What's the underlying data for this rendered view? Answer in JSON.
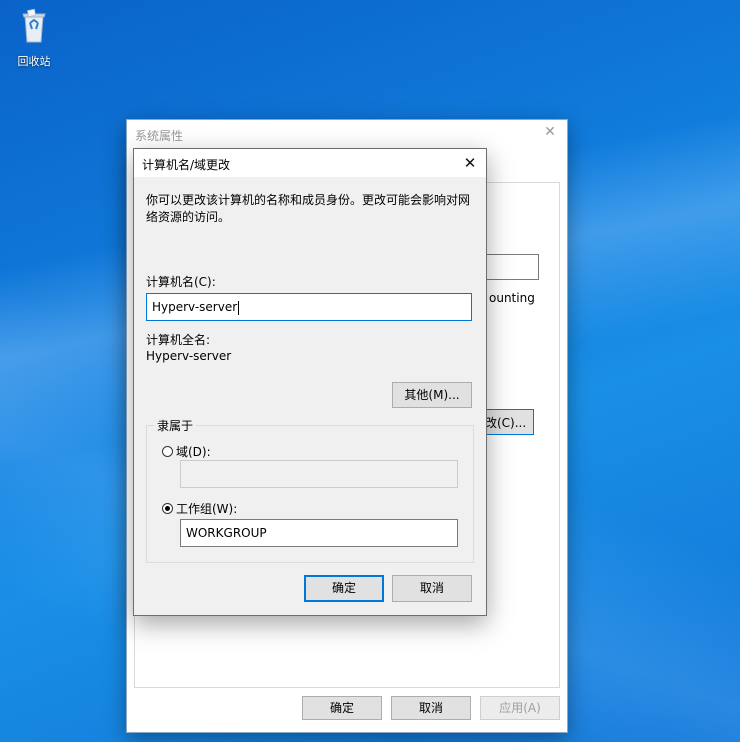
{
  "desktop": {
    "recycle_bin_label": "回收站"
  },
  "back_dialog": {
    "title": "系统属性",
    "partial_text": "ounting",
    "change_button": "改(C)...",
    "ok_label": "确定",
    "cancel_label": "取消",
    "apply_label": "应用(A)"
  },
  "front_dialog": {
    "title": "计算机名/域更改",
    "description": "你可以更改该计算机的名称和成员身份。更改可能会影响对网络资源的访问。",
    "computer_name_label": "计算机名(C):",
    "computer_name_value": "Hyperv-server",
    "full_name_label": "计算机全名:",
    "full_name_value": "Hyperv-server",
    "more_button": "其他(M)...",
    "member_of_label": "隶属于",
    "domain_radio_label": "域(D):",
    "domain_value": "",
    "workgroup_radio_label": "工作组(W):",
    "workgroup_value": "WORKGROUP",
    "selected_membership": "workgroup",
    "ok_label": "确定",
    "cancel_label": "取消"
  },
  "colors": {
    "accent": "#0078d7",
    "desktop_blue": "#1282e0"
  }
}
